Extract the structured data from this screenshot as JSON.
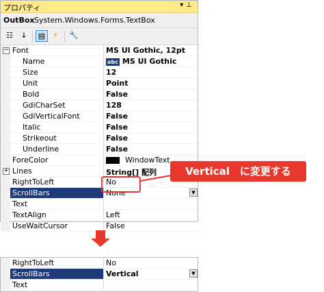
{
  "title": "プロパティ",
  "title_icons": [
    "chevron-down-icon",
    "pin-icon"
  ],
  "object": {
    "name": "OutBox",
    "type": "System.Windows.Forms.TextBox"
  },
  "toolbar": [
    "categorized-icon",
    "alphabetical-icon",
    "properties-icon",
    "events-icon",
    "property-pages-icon"
  ],
  "rows": [
    {
      "name": "Font",
      "value": "MS UI Gothic, 12pt",
      "bold": true,
      "expander": "−"
    },
    {
      "name": "Name",
      "value": "MS UI Gothic",
      "bold": true,
      "sub": true,
      "abc": "abc"
    },
    {
      "name": "Size",
      "value": "12",
      "bold": true,
      "sub": true
    },
    {
      "name": "Unit",
      "value": "Point",
      "bold": true,
      "sub": true
    },
    {
      "name": "Bold",
      "value": "False",
      "bold": true,
      "sub": true
    },
    {
      "name": "GdiCharSet",
      "value": "128",
      "bold": true,
      "sub": true
    },
    {
      "name": "GdiVerticalFont",
      "value": "False",
      "bold": true,
      "sub": true
    },
    {
      "name": "Italic",
      "value": "False",
      "bold": true,
      "sub": true
    },
    {
      "name": "Strikeout",
      "value": "False",
      "bold": true,
      "sub": true
    },
    {
      "name": "Underline",
      "value": "False",
      "bold": true,
      "sub": true
    },
    {
      "name": "ForeColor",
      "value": "WindowText",
      "swatch": true
    },
    {
      "name": "Lines",
      "value": "String[] 配列",
      "bold": true,
      "expander": "+"
    },
    {
      "name": "RightToLeft",
      "value": "No"
    },
    {
      "name": "ScrollBars",
      "value": "None",
      "selected": true
    },
    {
      "name": "Text",
      "value": ""
    },
    {
      "name": "TextAlign",
      "value": "Left"
    },
    {
      "name": "UseWaitCursor",
      "value": "False"
    }
  ],
  "callout": "Vertical　に変更する",
  "after_rows": [
    {
      "name": "RightToLeft",
      "value": "No"
    },
    {
      "name": "ScrollBars",
      "value": "Vertical",
      "bold": true,
      "selected": true
    },
    {
      "name": "Text",
      "value": ""
    }
  ],
  "colors": {
    "accent": "#e8372c",
    "selection": "#1e3a7b",
    "titlebar": "#ffe98b"
  }
}
